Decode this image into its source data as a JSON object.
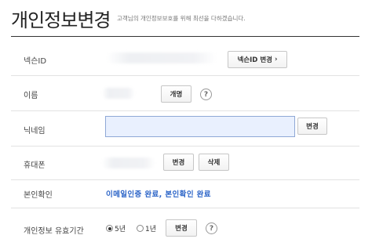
{
  "header": {
    "title": "개인정보변경",
    "subtitle": "고객님의 개인정보보호를 위해 최선을 다하겠습니다."
  },
  "rows": {
    "nexon_id": {
      "label": "넥슨ID",
      "button": "넥슨ID 변경",
      "button_arrow": "›"
    },
    "name": {
      "label": "이름",
      "button": "개명",
      "help": "?"
    },
    "nickname": {
      "label": "닉네임",
      "button": "변경"
    },
    "phone": {
      "label": "휴대폰",
      "change_button": "변경",
      "delete_button": "삭제"
    },
    "verification": {
      "label": "본인확인",
      "status": "이메일인증 완료, 본인확인 완료"
    },
    "retention": {
      "label": "개인정보 유효기간",
      "options": [
        {
          "label": "5년",
          "selected": true
        },
        {
          "label": "1년",
          "selected": false
        }
      ],
      "button": "변경",
      "help": "?"
    }
  },
  "colors": {
    "accent_text": "#2a63c7",
    "input_fill": "#e9f0fe"
  }
}
